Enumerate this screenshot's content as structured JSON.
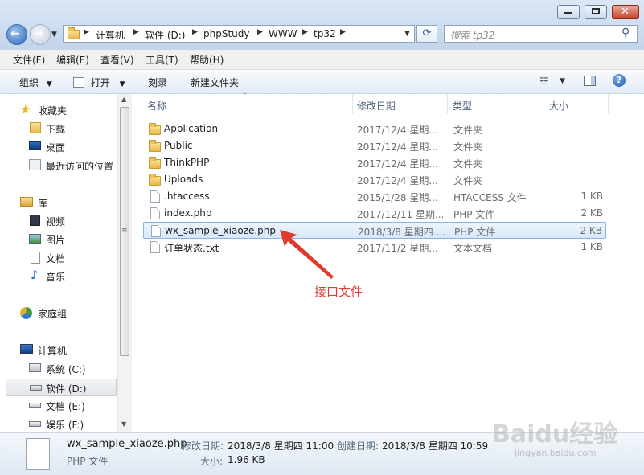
{
  "address": {
    "crumbs": [
      "计算机",
      "软件 (D:)",
      "phpStudy",
      "WWW",
      "tp32"
    ],
    "search_placeholder": "搜索 tp32"
  },
  "menu": [
    "文件(F)",
    "编辑(E)",
    "查看(V)",
    "工具(T)",
    "帮助(H)"
  ],
  "toolbar": {
    "organize": "组织",
    "open": "打开",
    "burn": "刻录",
    "new_folder": "新建文件夹"
  },
  "nav": {
    "favorites": "收藏夹",
    "downloads": "下载",
    "desktop": "桌面",
    "recent": "最近访问的位置",
    "libraries": "库",
    "videos": "视频",
    "pictures": "图片",
    "documents": "文档",
    "music": "音乐",
    "homegroup": "家庭组",
    "computer": "计算机",
    "drive_c": "系统 (C:)",
    "drive_d": "软件 (D:)",
    "drive_e": "文档 (E:)",
    "drive_f": "娱乐 (F:)"
  },
  "columns": {
    "name": "名称",
    "modified": "修改日期",
    "type": "类型",
    "size": "大小"
  },
  "files": [
    {
      "name": "Application",
      "modified": "2017/12/4 星期...",
      "type": "文件夹",
      "size": "",
      "icon": "folder-icon"
    },
    {
      "name": "Public",
      "modified": "2017/12/4 星期...",
      "type": "文件夹",
      "size": "",
      "icon": "folder-icon"
    },
    {
      "name": "ThinkPHP",
      "modified": "2017/12/4 星期...",
      "type": "文件夹",
      "size": "",
      "icon": "folder-icon"
    },
    {
      "name": "Uploads",
      "modified": "2017/12/4 星期...",
      "type": "文件夹",
      "size": "",
      "icon": "folder-icon"
    },
    {
      "name": ".htaccess",
      "modified": "2015/1/28 星期...",
      "type": "HTACCESS 文件",
      "size": "1 KB",
      "icon": "file-icon"
    },
    {
      "name": "index.php",
      "modified": "2017/12/11 星期...",
      "type": "PHP 文件",
      "size": "2 KB",
      "icon": "file-icon"
    },
    {
      "name": "wx_sample_xiaoze.php",
      "modified": "2018/3/8 星期四 ...",
      "type": "PHP 文件",
      "size": "2 KB",
      "icon": "file-icon"
    },
    {
      "name": "订单状态.txt",
      "modified": "2017/11/2 星期...",
      "type": "文本文档",
      "size": "1 KB",
      "icon": "file-icon"
    }
  ],
  "annotation": "接口文件",
  "details": {
    "filename": "wx_sample_xiaoze.php",
    "filetype": "PHP 文件",
    "modified_label": "修改日期:",
    "modified_value": "2018/3/8 星期四 11:00",
    "created_label": "创建日期:",
    "created_value": "2018/3/8 星期四 10:59",
    "size_label": "大小:",
    "size_value": "1.96 KB"
  },
  "watermark": {
    "brand": "Baidu经验",
    "url": "jingyan.baidu.com"
  },
  "colors": {
    "annotation": "#e03a2c",
    "selection": "#d7e8fb",
    "accent": "#2d66b5"
  }
}
